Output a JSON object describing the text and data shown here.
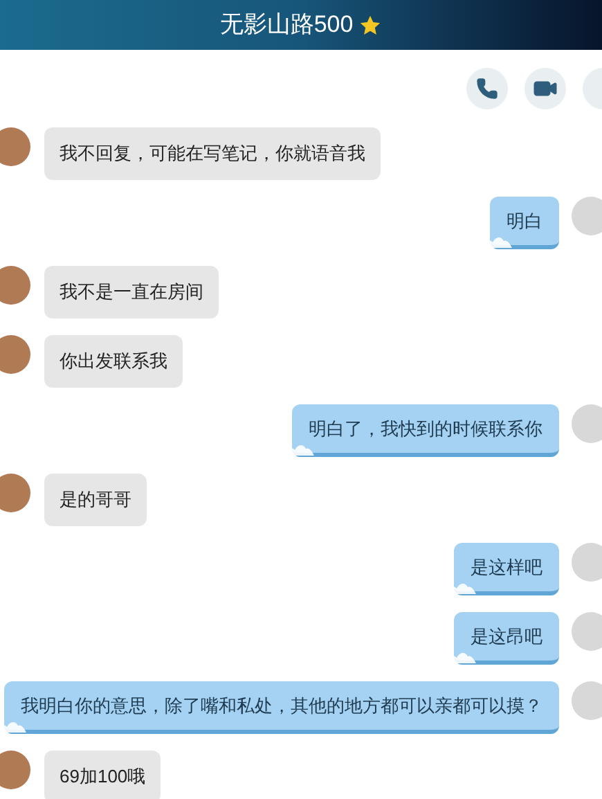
{
  "header": {
    "title": "无影山路500"
  },
  "messages": [
    {
      "kind": "received",
      "text": "我不回复，可能在写笔记，你就语音我"
    },
    {
      "kind": "sent",
      "text": "明白"
    },
    {
      "kind": "received",
      "text": "我不是一直在房间"
    },
    {
      "kind": "received",
      "text": "你出发联系我"
    },
    {
      "kind": "sent",
      "text": "明白了，我快到的时候联系你"
    },
    {
      "kind": "received",
      "text": "是的哥哥"
    },
    {
      "kind": "sent",
      "text": "是这样吧"
    },
    {
      "kind": "sent",
      "text": "是这昂吧"
    },
    {
      "kind": "sent",
      "text": "我明白你的意思，除了嘴和私处，其他的地方都可以亲都可以摸？"
    },
    {
      "kind": "received",
      "text": "69加100哦"
    }
  ]
}
